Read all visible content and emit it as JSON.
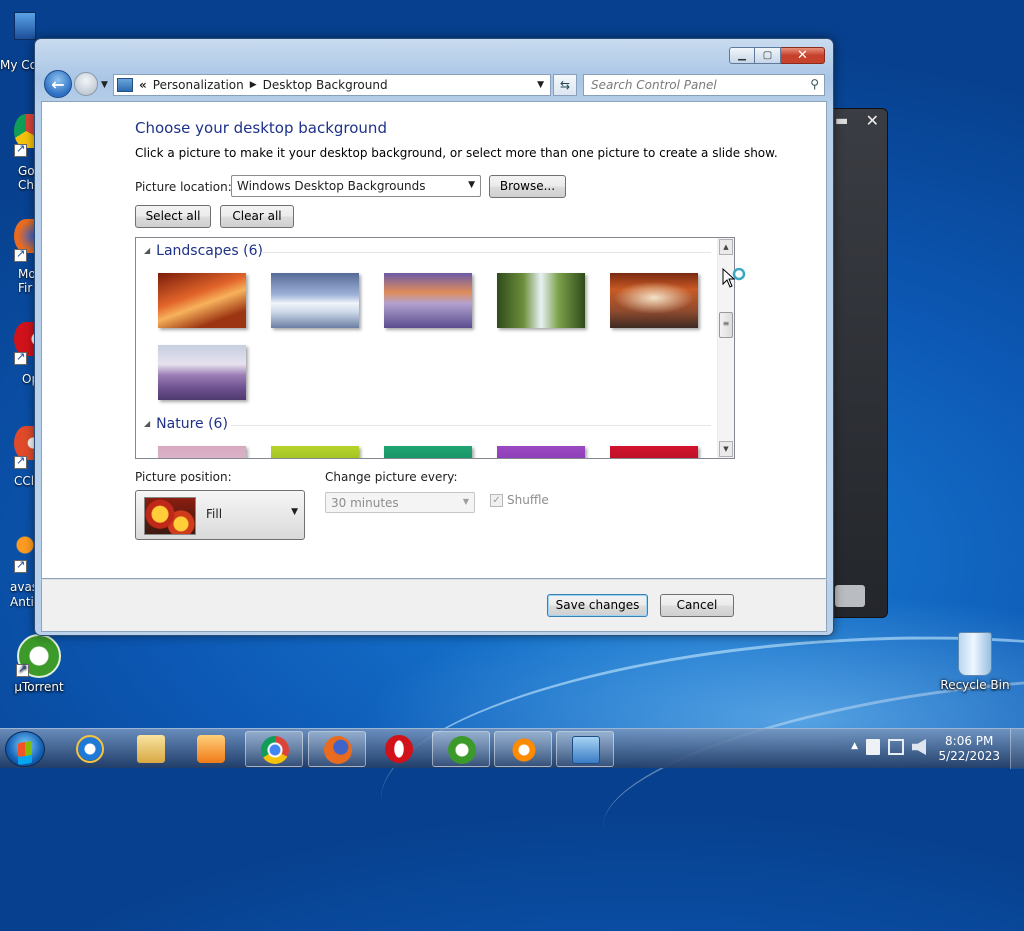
{
  "desktop": {
    "icons": [
      {
        "label": "My Co"
      },
      {
        "label": "Go Chr"
      },
      {
        "label": "Mo Fir"
      },
      {
        "label": "Op"
      },
      {
        "label": "CCl"
      },
      {
        "label": "avas Anti"
      },
      {
        "label": "µTorrent"
      },
      {
        "label": "Recycle Bin"
      }
    ]
  },
  "window": {
    "address": {
      "root": "Personalization",
      "current": "Desktop Background"
    },
    "search_placeholder": "Search Control Panel",
    "title": "Choose your desktop background",
    "subtitle": "Click a picture to make it your desktop background, or select more than one picture to create a slide show.",
    "picture_location_label": "Picture location:",
    "picture_location_value": "Windows Desktop Backgrounds",
    "browse_label": "Browse...",
    "select_all_label": "Select all",
    "clear_all_label": "Clear all",
    "groups": [
      {
        "name": "Landscapes (6)"
      },
      {
        "name": "Nature (6)"
      }
    ],
    "picture_position_label": "Picture position:",
    "picture_position_value": "Fill",
    "change_every_label": "Change picture every:",
    "change_every_value": "30 minutes",
    "shuffle_label": "Shuffle",
    "shuffle_checked": true,
    "save_label": "Save changes",
    "cancel_label": "Cancel"
  },
  "taskbar": {
    "time": "8:06 PM",
    "date": "5/22/2023"
  }
}
